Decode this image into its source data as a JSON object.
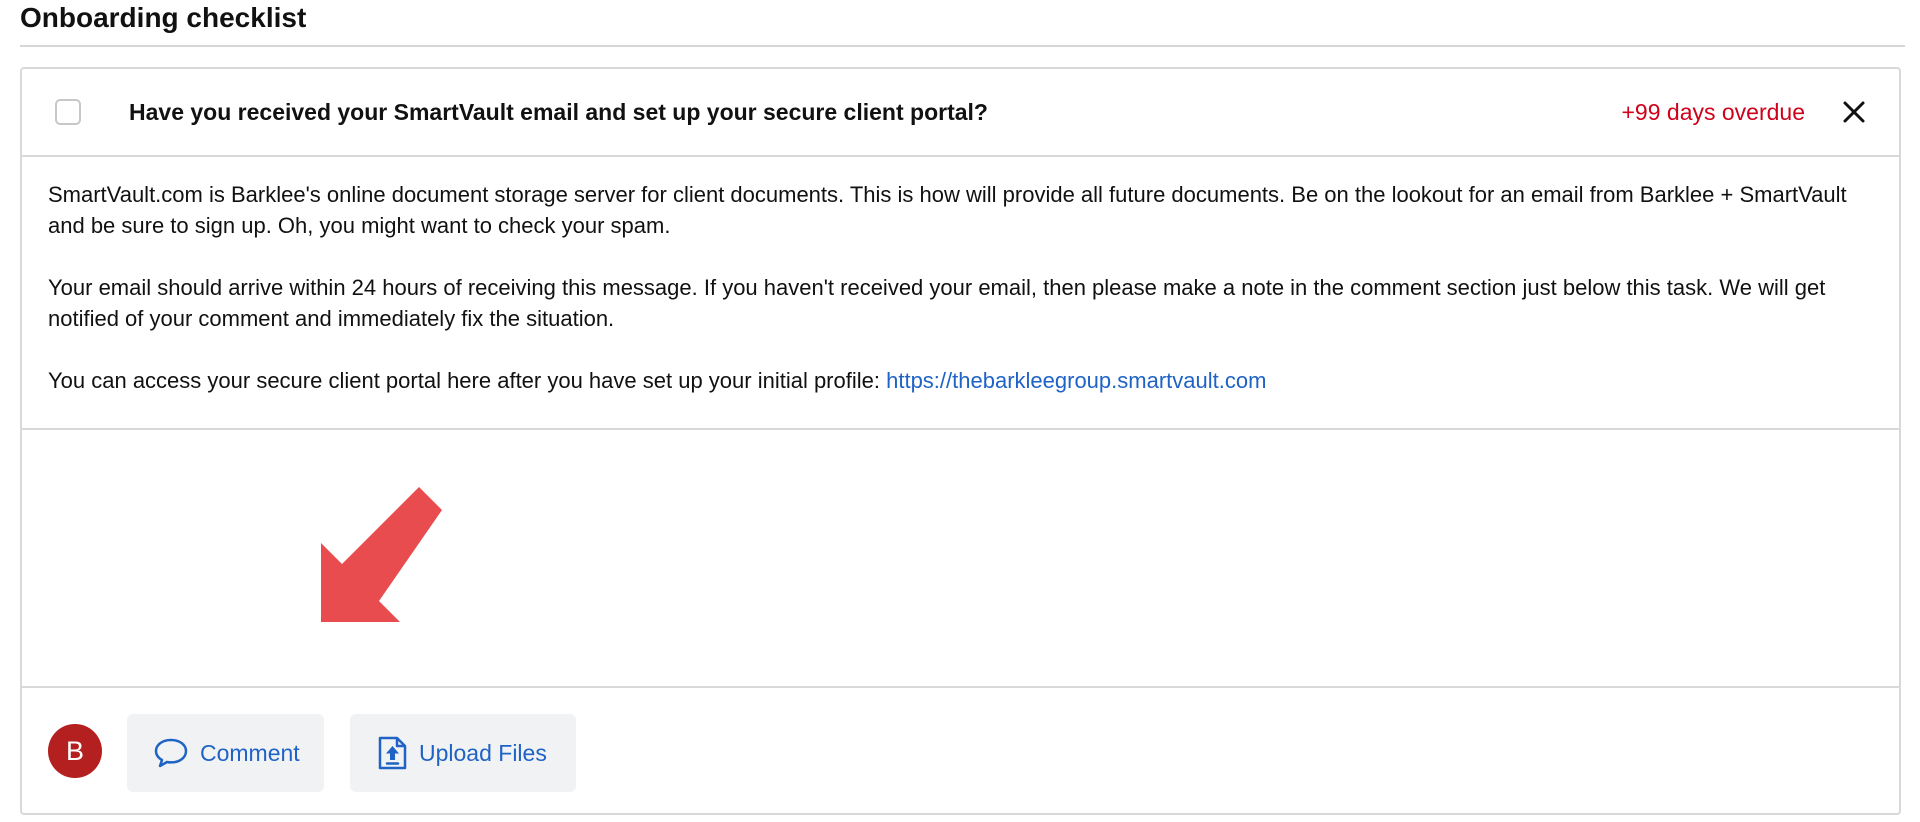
{
  "page": {
    "title": "Onboarding checklist"
  },
  "task": {
    "title": "Have you received your SmartVault email and set up your secure client portal?",
    "overdue_label": "+99 days overdue",
    "completed": false,
    "close_icon": "close-icon",
    "body": {
      "paragraph1": "SmartVault.com is Barklee's online document storage server for client documents. This is how will provide all future documents. Be on the lookout for an email from Barklee + SmartVault and be sure to sign up. Oh, you might want to check your spam.",
      "paragraph2": "Your email should arrive within 24 hours of receiving this message. If you haven't received your email, then please make a note in the comment section just below this task. We will get notified of your comment and immediately fix the situation.",
      "paragraph3_prefix": "You can access your secure client portal here after you have set up your initial profile: ",
      "portal_link": "https://thebarkleegroup.smartvault.com"
    }
  },
  "footer": {
    "avatar_initial": "B",
    "comment_label": "Comment",
    "comment_icon": "speech-bubble-icon",
    "upload_label": "Upload Files",
    "upload_icon": "file-upload-icon"
  },
  "colors": {
    "overdue": "#d0021b",
    "link": "#1f63c6",
    "avatar": "#b3201f",
    "annotation_arrow": "#e84c4f",
    "button_bg": "#f1f2f3"
  }
}
